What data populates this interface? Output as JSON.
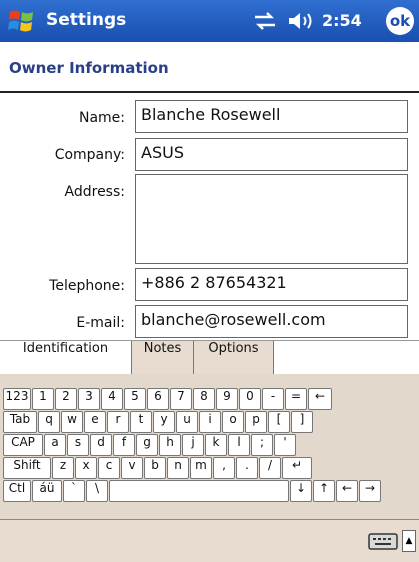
{
  "titlebar": {
    "app_title": "Settings",
    "time": "2:54",
    "ok_label": "ok"
  },
  "page": {
    "title": "Owner Information"
  },
  "form": {
    "name_label": "Name:",
    "name_value": "Blanche Rosewell",
    "company_label": "Company:",
    "company_value": "ASUS",
    "address_label": "Address:",
    "address_value": "",
    "telephone_label": "Telephone:",
    "telephone_value": "+886 2 87654321",
    "email_label": "E-mail:",
    "email_value": "blanche@rosewell.com"
  },
  "tabs": [
    {
      "label": "Identification",
      "active": true
    },
    {
      "label": "Notes",
      "active": false
    },
    {
      "label": "Options",
      "active": false
    }
  ],
  "keyboard": {
    "rows": [
      [
        "123",
        "1",
        "2",
        "3",
        "4",
        "5",
        "6",
        "7",
        "8",
        "9",
        "0",
        "-",
        "=",
        "←"
      ],
      [
        "Tab",
        "q",
        "w",
        "e",
        "r",
        "t",
        "y",
        "u",
        "i",
        "o",
        "p",
        "[",
        "]"
      ],
      [
        "CAP",
        "a",
        "s",
        "d",
        "f",
        "g",
        "h",
        "j",
        "k",
        "l",
        ";",
        "'"
      ],
      [
        "Shift",
        "z",
        "x",
        "c",
        "v",
        "b",
        "n",
        "m",
        ",",
        ".",
        "/",
        "↵"
      ],
      [
        "Ctl",
        "áü",
        "`",
        "\\",
        "",
        "↓",
        "↑",
        "←",
        "→"
      ]
    ]
  },
  "icons": {
    "windows_logo": "windows-flag-icon",
    "connectivity": "connectivity-icon",
    "volume": "volume-icon",
    "keyboard": "keyboard-icon"
  },
  "colors": {
    "titlebar": "#1a4fb0",
    "page_title": "#2a3f8a",
    "keyboard_bg": "#e3d8cc"
  }
}
